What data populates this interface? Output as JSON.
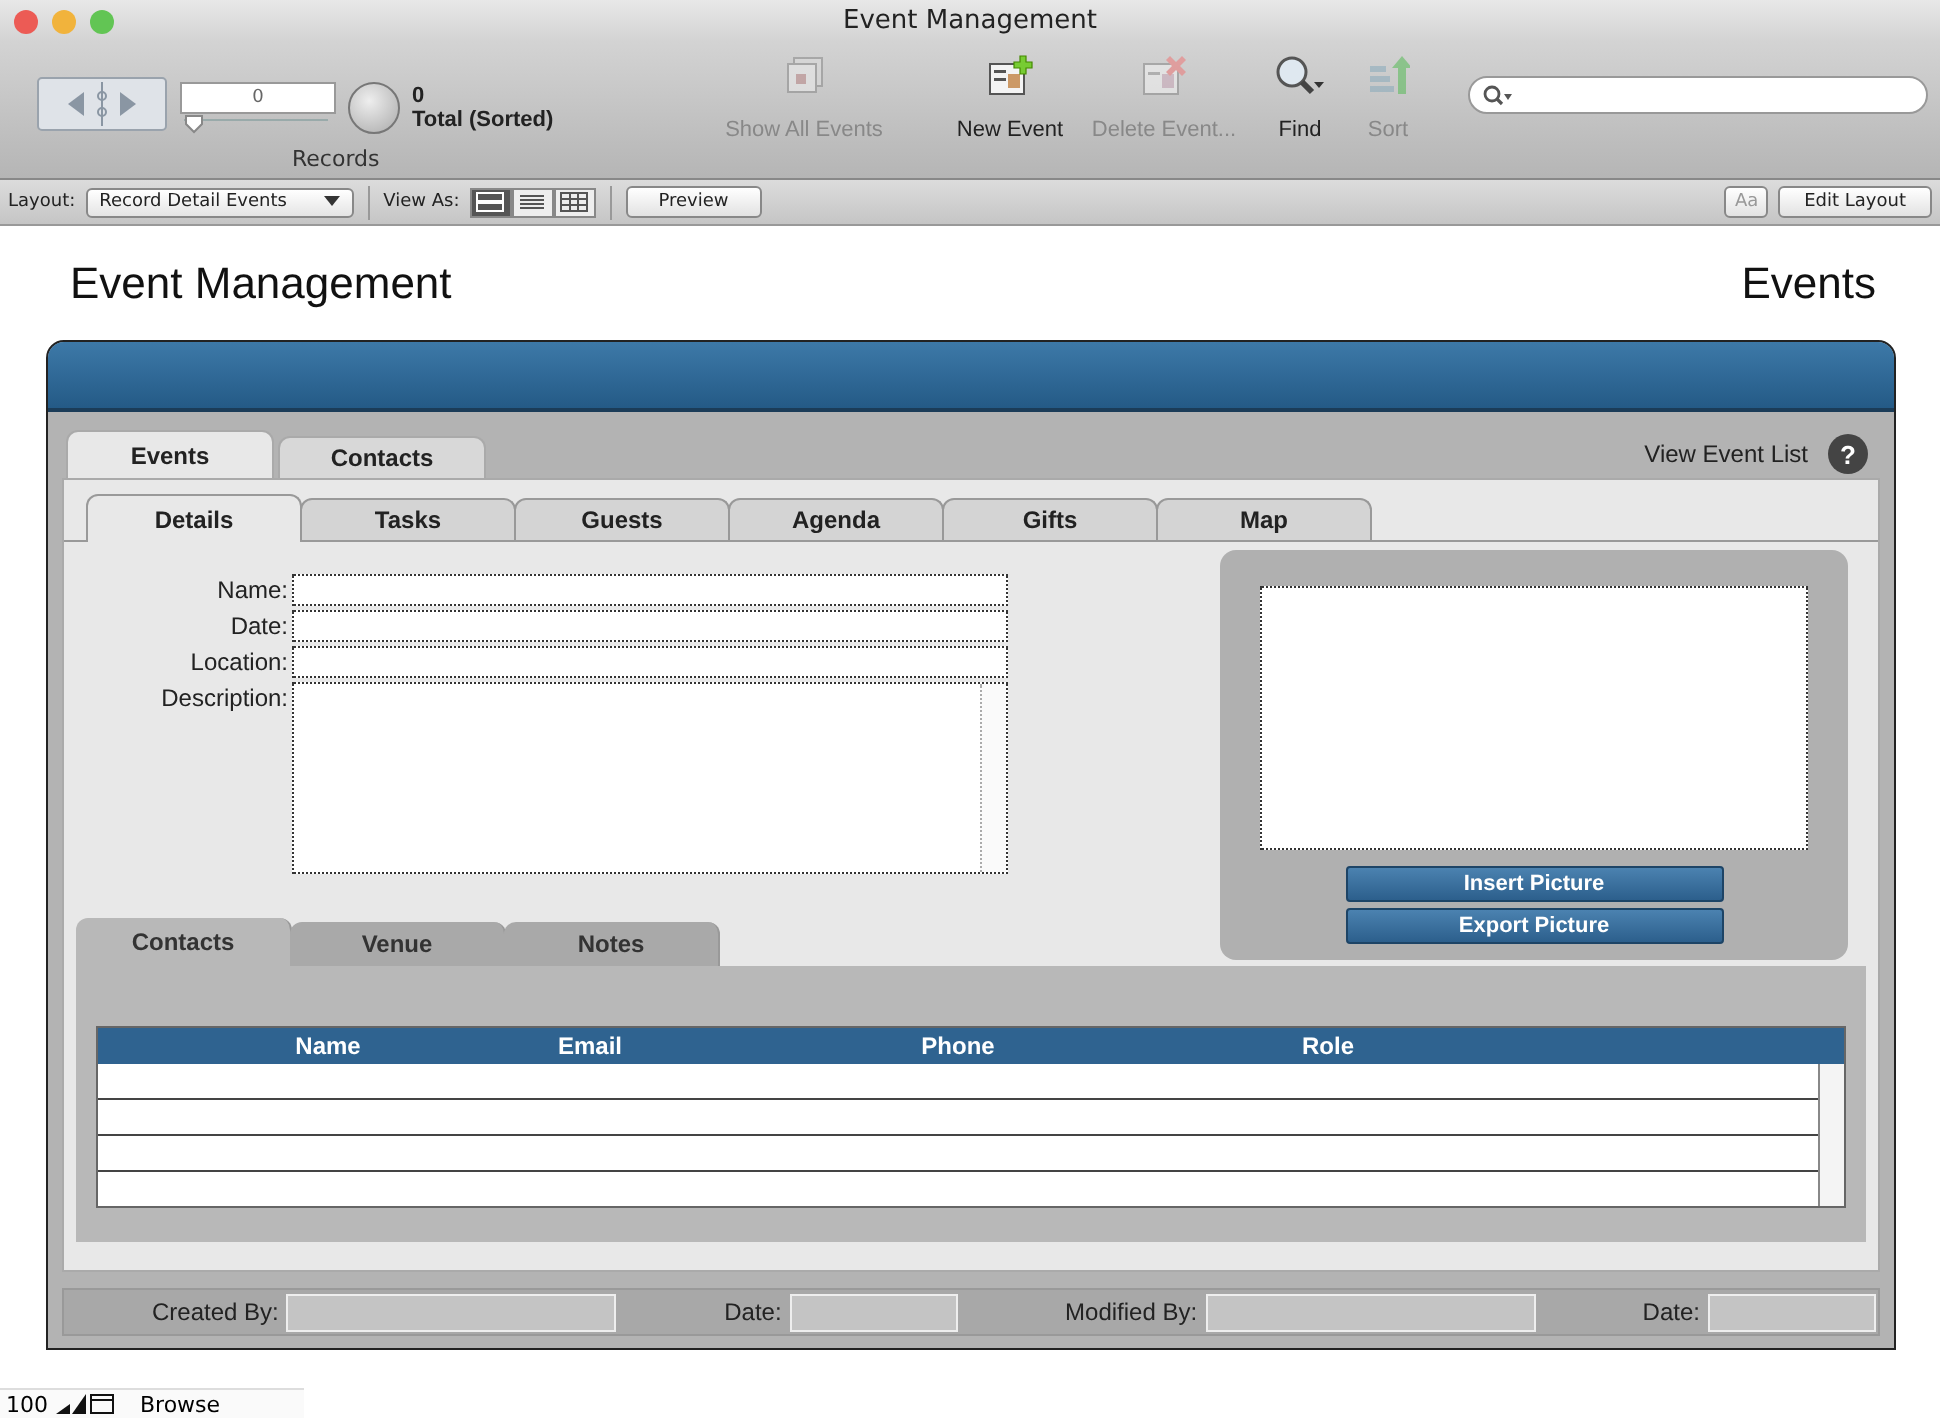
{
  "window": {
    "title": "Event Management"
  },
  "toolbar": {
    "record_field": "0",
    "record_slider": {
      "level": 0
    },
    "found_count": "0",
    "found_label": "Total (Sorted)",
    "records_label": "Records",
    "buttons": [
      {
        "kind": "show_all",
        "label": "Show All Events",
        "disabled": true
      },
      {
        "kind": "new",
        "label": "New Event",
        "disabled": false
      },
      {
        "kind": "delete",
        "label": "Delete Event...",
        "disabled": true
      },
      {
        "kind": "find",
        "label": "Find",
        "disabled": false
      },
      {
        "kind": "sort",
        "label": "Sort",
        "disabled": true
      }
    ]
  },
  "layout_bar": {
    "layout_label": "Layout:",
    "layout_value": "Record Detail Events",
    "view_as_label": "View As:",
    "view_modes": [
      {
        "kind": "form",
        "selected": true
      },
      {
        "kind": "list",
        "selected": false
      },
      {
        "kind": "table",
        "selected": false
      }
    ],
    "preview": "Preview",
    "font_button": "Aa",
    "edit_layout": "Edit Layout"
  },
  "header": {
    "title": "Event Management",
    "section": "Events"
  },
  "main_tabs": [
    {
      "label": "Events",
      "selected": true
    },
    {
      "label": "Contacts",
      "selected": false
    }
  ],
  "view_event_list": "View Event List",
  "help": "?",
  "sub_tabs": [
    {
      "label": "Details",
      "selected": true
    },
    {
      "label": "Tasks",
      "selected": false
    },
    {
      "label": "Guests",
      "selected": false
    },
    {
      "label": "Agenda",
      "selected": false
    },
    {
      "label": "Gifts",
      "selected": false
    },
    {
      "label": "Map",
      "selected": false
    }
  ],
  "fields": [
    {
      "label": "Name:",
      "kind": "line"
    },
    {
      "label": "Date:",
      "kind": "line"
    },
    {
      "label": "Location:",
      "kind": "line"
    },
    {
      "label": "Description:",
      "kind": "area"
    }
  ],
  "picture_buttons": [
    "Insert Picture",
    "Export Picture"
  ],
  "lower_tabs": [
    {
      "label": "Contacts",
      "selected": true
    },
    {
      "label": "Venue",
      "selected": false
    },
    {
      "label": "Notes",
      "selected": false
    }
  ],
  "contacts_table": {
    "columns": [
      "Name",
      "Email",
      "Phone",
      "Role"
    ]
  },
  "footer_fields": [
    {
      "label": "Created By:"
    },
    {
      "label": "Date:"
    },
    {
      "label": "Modified By:"
    },
    {
      "label": "Date:"
    }
  ],
  "status_bar": {
    "zoom": "100",
    "mode": "Browse"
  }
}
